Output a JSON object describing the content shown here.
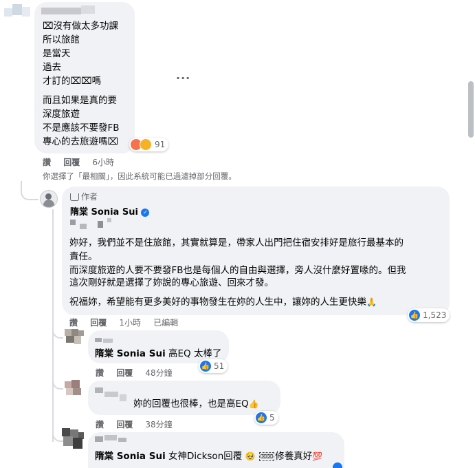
{
  "top_comment": {
    "lines_a": [
      "⌧沒有做太多功課",
      "所以旅館",
      "是當天",
      "過去",
      "才訂的⌧⌧嗎"
    ],
    "lines_b": [
      "而且如果是真的要",
      "深度旅遊",
      "不是應該不要發FB",
      "專心的去旅遊嗎⌧"
    ],
    "reaction_count": "91",
    "actions": {
      "like": "讚",
      "reply": "回覆",
      "time": "6小時"
    },
    "more": "···"
  },
  "filter_notice": "你選擇了「最相關」，因此系統可能已過濾掉部分回覆。",
  "author_reply": {
    "badge": "作者",
    "name": "隋棠 Sonia Sui",
    "paragraph1": [
      "妳好，我們並不是住旅館，其實就算是，帶家人出門把住宿安排好是旅行最基本的",
      "責任。"
    ],
    "paragraph2": [
      "而深度旅遊的人要不要發FB也是每個人的自由與選擇，旁人沒什麼好置喙的。但我",
      "這次剛好就是選擇了妳說的專心旅遊、回來才發。"
    ],
    "paragraph3": "祝福妳，希望能有更多美好的事物發生在妳的人生中，讓妳的人生更快樂",
    "reaction_count": "1,523",
    "actions": {
      "like": "讚",
      "reply": "回覆",
      "time": "1小時",
      "edited": "已編輯"
    }
  },
  "replies": [
    {
      "tag": "隋棠 Sonia Sui",
      "text": "高EQ 太棒了",
      "count": "51",
      "like": "讚",
      "reply": "回覆",
      "time": "48分鐘"
    },
    {
      "tag": "",
      "text": "妳的回覆也很棒，也是高EQ",
      "count": "5",
      "like": "讚",
      "reply": "回覆",
      "time": "38分鐘"
    },
    {
      "tag": "隋棠 Sonia Sui",
      "text": "女神Dickson回覆",
      "text2": "修養真好",
      "emoji1": "🥹",
      "emoji2": "💯"
    }
  ],
  "colors": {
    "bubble": "#f0f2f5",
    "meta": "#65676b",
    "like_blue": "#1877f2",
    "verified": "#1877f2",
    "angry": "#f7714c",
    "haha": "#f7b125"
  },
  "icons": [
    "angry-reaction-icon",
    "haha-reaction-icon",
    "like-icon",
    "verified-badge-icon",
    "pray-emoji",
    "thumbs-up-emoji",
    "pleading-face-emoji",
    "hundred-points-emoji",
    "more-options-icon"
  ]
}
